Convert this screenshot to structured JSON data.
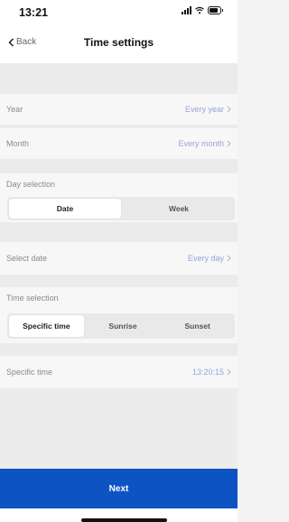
{
  "status_bar": {
    "time": "13:21",
    "battery_level": 0.8
  },
  "header": {
    "back_label": "Back",
    "title": "Time settings"
  },
  "rows": {
    "year": {
      "label": "Year",
      "value": "Every year"
    },
    "month": {
      "label": "Month",
      "value": "Every month"
    },
    "select_date": {
      "label": "Select date",
      "value": "Every day"
    },
    "specific_time": {
      "label": "Specific time",
      "value": "13:20:15"
    }
  },
  "day_selection": {
    "label": "Day selection",
    "options": [
      "Date",
      "Week"
    ],
    "selected": "Date"
  },
  "time_selection": {
    "label": "Time selection",
    "options": [
      "Specific time",
      "Sunrise",
      "Sunset"
    ],
    "selected": "Specific time"
  },
  "footer": {
    "next_label": "Next"
  },
  "colors": {
    "accent": "#0d53c4",
    "value_text": "#9aa3d8"
  },
  "icons": {
    "back": "chevron-left-icon",
    "row_arrow": "chevron-right-icon"
  }
}
